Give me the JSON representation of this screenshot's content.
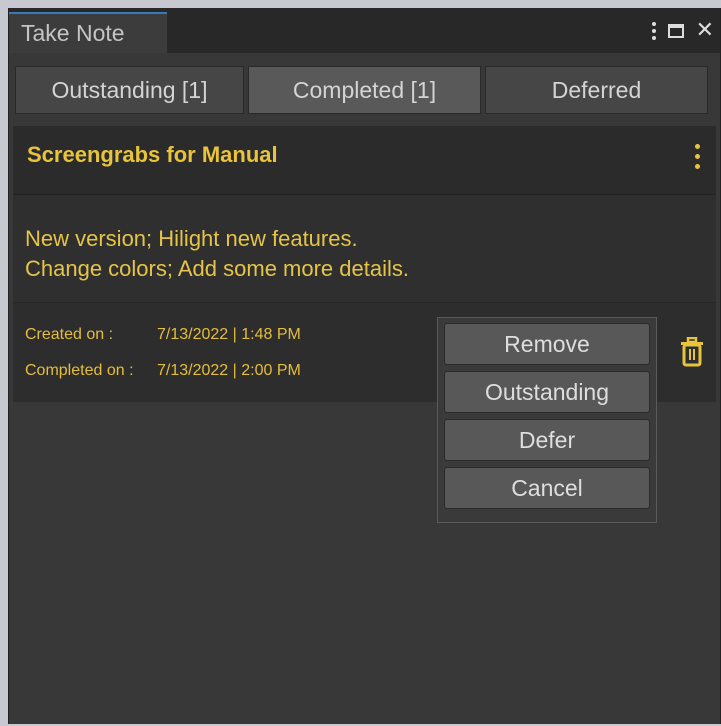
{
  "window": {
    "title": "Take Note"
  },
  "tabs": [
    {
      "label": "Outstanding [1]",
      "selected": false
    },
    {
      "label": "Completed [1]",
      "selected": true
    },
    {
      "label": "Deferred",
      "selected": false
    }
  ],
  "note": {
    "title": "Screengrabs for Manual",
    "body_lines": [
      "New version; Hilight new features.",
      "Change colors; Add some more details."
    ],
    "created_label": "Created on :",
    "created_value": "7/13/2022 | 1:48 PM",
    "completed_label": "Completed on :",
    "completed_value": "7/13/2022 | 2:00 PM"
  },
  "popup": {
    "remove": "Remove",
    "outstanding": "Outstanding",
    "defer": "Defer",
    "cancel": "Cancel"
  },
  "colors": {
    "accent": "#e8c33c",
    "background": "#383838",
    "tab_active": "#595959",
    "tab_underline": "#3a79bb"
  },
  "icons": [
    "more-vert-icon",
    "maximize-icon",
    "close-icon",
    "more-vert-icon",
    "trash-icon"
  ]
}
